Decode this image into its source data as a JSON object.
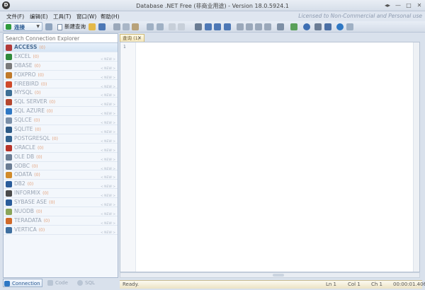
{
  "window": {
    "title": "Database .NET Free (非商业用途) - Version 18.0.5924.1",
    "logo_char": "D",
    "controls": [
      "◂▸",
      "—",
      "□",
      "✕"
    ]
  },
  "menu": {
    "items": [
      "文件(F)",
      "编辑(E)",
      "工具(T)",
      "窗口(W)",
      "帮助(H)"
    ],
    "license_text": "Licensed to Non-Commercial and Personal use"
  },
  "toolbar": {
    "connect_label": "连接",
    "new_query_label": "新建查询",
    "icons": [
      "save-icon",
      "open-folder-icon",
      "disk-icon",
      "cut-icon",
      "copy-icon",
      "paste-icon",
      "undo-icon",
      "redo-icon",
      "run-icon",
      "grid-icon",
      "check-icon",
      "export-icon",
      "import-icon",
      "table-icon",
      "align-left-icon",
      "align-center-icon",
      "indent-icon",
      "outdent-icon",
      "chart-icon",
      "edit-icon",
      "settings-icon",
      "tools-icon",
      "connect-icon",
      "help-icon",
      "download-icon"
    ]
  },
  "explorer": {
    "search_placeholder": "Search Connection Explorer",
    "items": [
      {
        "name": "ACCESS",
        "count": "(0)",
        "sub": "",
        "color": "#b23a3a"
      },
      {
        "name": "EXCEL",
        "count": "(0)",
        "sub": "< NEW >",
        "color": "#2f8a3b"
      },
      {
        "name": "DBASE",
        "count": "(0)",
        "sub": "< NEW >",
        "color": "#7a7a7a"
      },
      {
        "name": "FOXPRO",
        "count": "(0)",
        "sub": "< NEW >",
        "color": "#c07a2a"
      },
      {
        "name": "FIREBIRD",
        "count": "(0)",
        "sub": "< NEW >",
        "color": "#d04a2a"
      },
      {
        "name": "MYSQL",
        "count": "(0)",
        "sub": "< NEW >",
        "color": "#3d6f95"
      },
      {
        "name": "SQL SERVER",
        "count": "(0)",
        "sub": "< NEW >",
        "color": "#b5472f"
      },
      {
        "name": "SQL AZURE",
        "count": "(0)",
        "sub": "< NEW >",
        "color": "#2f78c4"
      },
      {
        "name": "SQLCE",
        "count": "(0)",
        "sub": "< NEW >",
        "color": "#7a8fa8"
      },
      {
        "name": "SQLITE",
        "count": "(0)",
        "sub": "< NEW >",
        "color": "#2d5a86"
      },
      {
        "name": "POSTGRESQL",
        "count": "(0)",
        "sub": "< NEW >",
        "color": "#33638f"
      },
      {
        "name": "ORACLE",
        "count": "(0)",
        "sub": "< NEW >",
        "color": "#b8342a"
      },
      {
        "name": "OLE DB",
        "count": "(0)",
        "sub": "< NEW >",
        "color": "#6a7c93"
      },
      {
        "name": "ODBC",
        "count": "(0)",
        "sub": "< NEW >",
        "color": "#6a7c93"
      },
      {
        "name": "ODATA",
        "count": "(0)",
        "sub": "< NEW >",
        "color": "#d18b2a"
      },
      {
        "name": "DB2",
        "count": "(0)",
        "sub": "< NEW >",
        "color": "#2a5c9a"
      },
      {
        "name": "INFORMIX",
        "count": "(0)",
        "sub": "< NEW >",
        "color": "#4a4a4a"
      },
      {
        "name": "SYBASE ASE",
        "count": "(0)",
        "sub": "< NEW >",
        "color": "#2a5c9a"
      },
      {
        "name": "NUODB",
        "count": "(0)",
        "sub": "< NEW >",
        "color": "#8aa55a"
      },
      {
        "name": "TERADATA",
        "count": "(0)",
        "sub": "< NEW >",
        "color": "#d06a2a"
      },
      {
        "name": "VERTICA",
        "count": "(0)",
        "sub": "< NEW >",
        "color": "#3f6f9f"
      }
    ]
  },
  "bottom_tabs": [
    {
      "label": "Connection",
      "active": true,
      "color": "#2f78c4"
    },
    {
      "label": "Code",
      "active": false,
      "color": "#8fa0b5"
    },
    {
      "label": "SQL",
      "active": false,
      "color": "#8fa0b5"
    }
  ],
  "editor": {
    "tab_label": "查询 (1)",
    "tab_close": "✕",
    "line_number": "1"
  },
  "status": {
    "message": "Ready.",
    "ln": "Ln 1",
    "col": "Col 1",
    "ch": "Ch 1",
    "elapsed": "00:00:01.406"
  }
}
